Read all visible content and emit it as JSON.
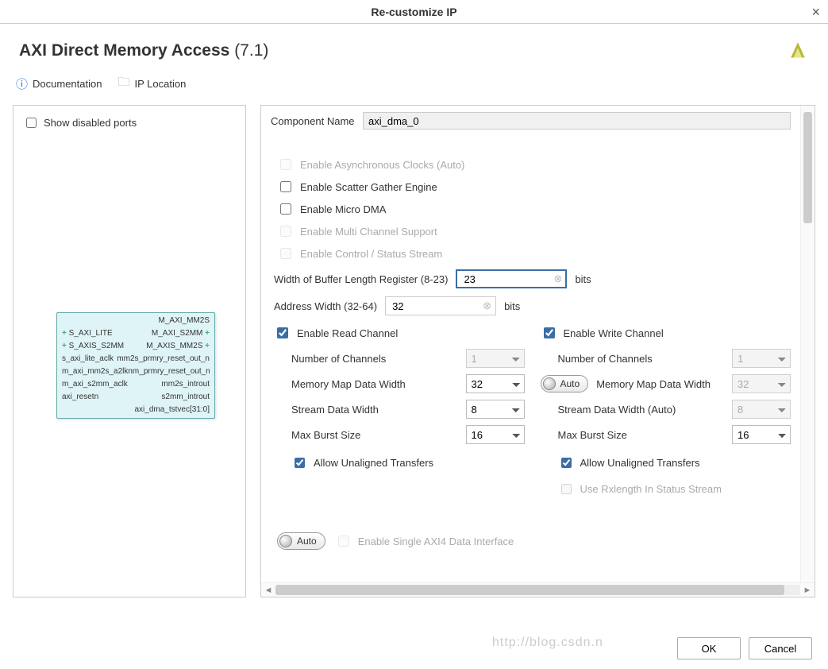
{
  "window": {
    "title": "Re-customize IP",
    "close_hint": "×"
  },
  "header": {
    "product": "AXI Direct Memory Access",
    "version": "(7.1)"
  },
  "toolbar": {
    "documentation": "Documentation",
    "ip_location": "IP Location"
  },
  "left": {
    "show_disabled_ports": "Show disabled ports",
    "block": {
      "rows": [
        {
          "l": "",
          "r": "M_AXI_MM2S"
        },
        {
          "l": "S_AXI_LITE",
          "r": "M_AXI_S2MM"
        },
        {
          "l": "S_AXIS_S2MM",
          "r": "M_AXIS_MM2S"
        },
        {
          "l": "s_axi_lite_aclk",
          "r": "mm2s_prmry_reset_out_n"
        },
        {
          "l": "m_axi_mm2s_a2lknm_prmry_reset_out_n",
          "r": ""
        },
        {
          "l": "m_axi_s2mm_aclk",
          "r": "mm2s_introut"
        },
        {
          "l": "axi_resetn",
          "r": "s2mm_introut"
        },
        {
          "l": "",
          "r": "axi_dma_tstvec[31:0]"
        }
      ]
    }
  },
  "cfg": {
    "component_name_label": "Component Name",
    "component_name": "axi_dma_0",
    "opts": {
      "async_clocks": "Enable Asynchronous Clocks (Auto)",
      "sg_engine": "Enable Scatter Gather Engine",
      "micro_dma": "Enable Micro DMA",
      "multi_channel": "Enable Multi Channel Support",
      "ctrl_status": "Enable Control / Status Stream"
    },
    "buffer_len": {
      "label": "Width of Buffer Length Register (8-23)",
      "value": "23",
      "unit": "bits"
    },
    "addr_width": {
      "label": "Address Width (32-64)",
      "value": "32",
      "unit": "bits"
    },
    "read": {
      "enable": "Enable Read Channel",
      "num_ch": {
        "label": "Number of Channels",
        "value": "1"
      },
      "mm_width": {
        "label": "Memory Map Data Width",
        "value": "32"
      },
      "stream_width": {
        "label": "Stream Data Width",
        "value": "8"
      },
      "burst": {
        "label": "Max Burst Size",
        "value": "16"
      },
      "unaligned": "Allow Unaligned Transfers"
    },
    "write": {
      "enable": "Enable Write Channel",
      "auto": "Auto",
      "num_ch": {
        "label": "Number of Channels",
        "value": "1"
      },
      "mm_width": {
        "label": "Memory Map Data Width",
        "value": "32"
      },
      "stream_width": {
        "label": "Stream Data Width (Auto)",
        "value": "8"
      },
      "burst": {
        "label": "Max Burst Size",
        "value": "16"
      },
      "unaligned": "Allow Unaligned Transfers",
      "rxlength": "Use Rxlength In Status Stream"
    },
    "bottom": {
      "auto": "Auto",
      "single_axi4": "Enable Single AXI4 Data Interface"
    }
  },
  "footer": {
    "ok": "OK",
    "cancel": "Cancel"
  },
  "watermark": "http://blog.csdn.n"
}
